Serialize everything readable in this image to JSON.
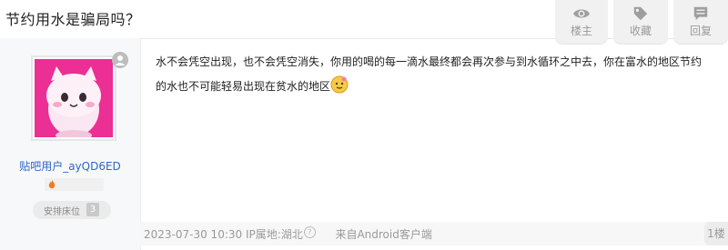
{
  "thread": {
    "title": "节约用水是骗局吗？"
  },
  "actions": [
    {
      "label": "楼主",
      "icon": "eye-icon"
    },
    {
      "label": "收藏",
      "icon": "tag-icon"
    },
    {
      "label": "回复",
      "icon": "comment-icon"
    }
  ],
  "post": {
    "author": {
      "name": "贴吧用户_ayQD6ED",
      "level_title": "安排床位",
      "level_num": "3"
    },
    "content": "水不会凭空出现，也不会凭空消失，你用的喝的每一滴水最终都会再次参与到水循环之中去，你在富水的地区节约的水也不可能轻易出现在贫水的地区",
    "meta": {
      "date": "2023-07-30 10:30",
      "ip": "IP属地:湖北",
      "source": "来自Android客户端",
      "floor": "1楼"
    }
  },
  "colors": {
    "link": "#2c68c8",
    "avatar_bg": "#ec2f94"
  }
}
